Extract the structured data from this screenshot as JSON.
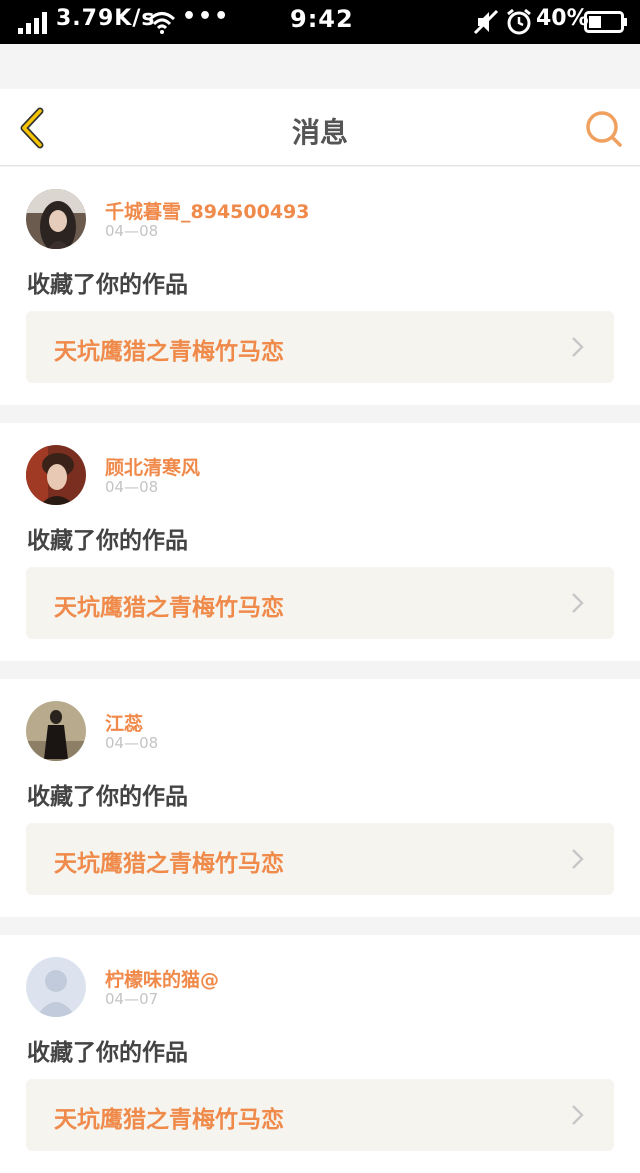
{
  "status_bar": {
    "speed": "3.79K/s",
    "more": "•••",
    "time": "9:42",
    "battery": "40%",
    "battery_level": 0.4
  },
  "nav": {
    "title": "消息",
    "back_icon": "chevron-left-icon",
    "search_icon": "search-icon"
  },
  "colors": {
    "accent": "#f08a4b",
    "back_icon": "#f5c400",
    "text": "#444444",
    "date": "#c4c4c4",
    "work_bg": "#f5f4ee"
  },
  "messages": [
    {
      "username": "千城暮雪_894500493",
      "date": "04—08",
      "action": "收藏了你的作品",
      "work_title": "天坑鹰猎之青梅竹马恋"
    },
    {
      "username": "顾北清寒风",
      "date": "04—08",
      "action": "收藏了你的作品",
      "work_title": "天坑鹰猎之青梅竹马恋"
    },
    {
      "username": "江蕊",
      "date": "04—08",
      "action": "收藏了你的作品",
      "work_title": "天坑鹰猎之青梅竹马恋"
    },
    {
      "username": "柠檬味的猫@",
      "date": "04—07",
      "action": "收藏了你的作品",
      "work_title": "天坑鹰猎之青梅竹马恋"
    }
  ]
}
